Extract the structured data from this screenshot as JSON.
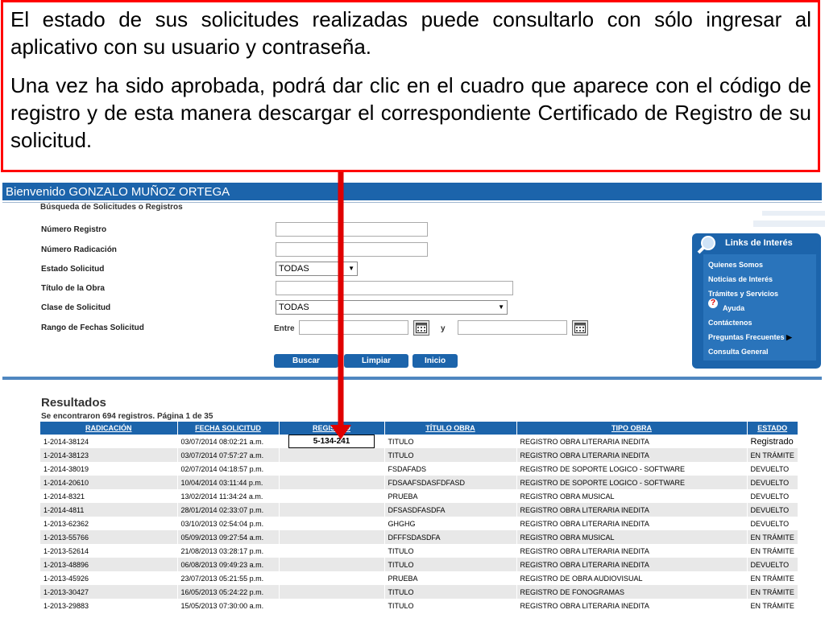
{
  "callout": {
    "paragraph1": "El estado de sus solicitudes realizadas puede consultarlo con sólo ingresar al aplicativo con su usuario y contraseña.",
    "paragraph2": "Una vez ha sido aprobada, podrá dar clic en el cuadro que aparece con el código de registro y de esta manera descargar el correspondiente Certificado de Registro de su solicitud."
  },
  "header": {
    "welcome": "Bienvenido GONZALO MUÑOZ ORTEGA"
  },
  "search": {
    "heading": "Búsqueda de Solicitudes o Registros",
    "labels": {
      "numero_registro": "Número Registro",
      "numero_radicacion": "Número Radicación",
      "estado_solicitud": "Estado Solicitud",
      "titulo_obra": "Título de la Obra",
      "clase_solicitud": "Clase de Solicitud",
      "rango_fechas": "Rango de Fechas Solicitud"
    },
    "estado_value": "TODAS",
    "clase_value": "TODAS",
    "entre_label": "Entre",
    "y_label": "y",
    "buttons": {
      "buscar": "Buscar",
      "limpiar": "Limpiar",
      "inicio": "Inicio"
    }
  },
  "links": {
    "title": "Links de Interés",
    "items": [
      "Quienes Somos",
      "Noticias de Interés",
      "Trámites y Servicios",
      "Ayuda",
      "Contáctenos",
      "Preguntas Frecuentes",
      "Consulta General"
    ]
  },
  "results": {
    "title": "Resultados",
    "count": "Se encontraron 694 registros. Página 1 de 35",
    "headers": [
      "RADICACIÓN",
      "FECHA SOLICITUD",
      "REGISTRO",
      "TÍTULO OBRA",
      "TIPO OBRA",
      "ESTADO"
    ],
    "rows": [
      [
        "1-2014-38124",
        "03/07/2014 08:02:21 a.m.",
        "5-134-241",
        "TITULO",
        "REGISTRO OBRA LITERARIA INEDITA",
        "Registrado"
      ],
      [
        "1-2014-38123",
        "03/07/2014 07:57:27 a.m.",
        "",
        "TITULO",
        "REGISTRO OBRA LITERARIA INEDITA",
        "EN TRÁMITE"
      ],
      [
        "1-2014-38019",
        "02/07/2014 04:18:57 p.m.",
        "",
        "FSDAFADS",
        "REGISTRO DE SOPORTE LOGICO - SOFTWARE",
        "DEVUELTO"
      ],
      [
        "1-2014-20610",
        "10/04/2014 03:11:44 p.m.",
        "",
        "FDSAAFSDASFDFASD",
        "REGISTRO DE SOPORTE LOGICO - SOFTWARE",
        "DEVUELTO"
      ],
      [
        "1-2014-8321",
        "13/02/2014 11:34:24 a.m.",
        "",
        "PRUEBA",
        "REGISTRO OBRA MUSICAL",
        "DEVUELTO"
      ],
      [
        "1-2014-4811",
        "28/01/2014 02:33:07 p.m.",
        "",
        "DFSASDFASDFA",
        "REGISTRO OBRA LITERARIA INEDITA",
        "DEVUELTO"
      ],
      [
        "1-2013-62362",
        "03/10/2013 02:54:04 p.m.",
        "",
        "GHGHG",
        "REGISTRO OBRA LITERARIA INEDITA",
        "DEVUELTO"
      ],
      [
        "1-2013-55766",
        "05/09/2013 09:27:54 a.m.",
        "",
        "DFFFSDASDFA",
        "REGISTRO OBRA MUSICAL",
        "EN TRÁMITE"
      ],
      [
        "1-2013-52614",
        "21/08/2013 03:28:17 p.m.",
        "",
        "TITULO",
        "REGISTRO OBRA LITERARIA INEDITA",
        "EN TRÁMITE"
      ],
      [
        "1-2013-48896",
        "06/08/2013 09:49:23 a.m.",
        "",
        "TITULO",
        "REGISTRO OBRA LITERARIA INEDITA",
        "DEVUELTO"
      ],
      [
        "1-2013-45926",
        "23/07/2013 05:21:55 p.m.",
        "",
        "PRUEBA",
        "REGISTRO DE OBRA AUDIOVISUAL",
        "EN TRÁMITE"
      ],
      [
        "1-2013-30427",
        "16/05/2013 05:24:22 p.m.",
        "",
        "TITULO",
        "REGISTRO DE FONOGRAMAS",
        "EN TRÁMITE"
      ],
      [
        "1-2013-29883",
        "15/05/2013 07:30:00 a.m.",
        "",
        "TITULO",
        "REGISTRO OBRA LITERARIA INEDITA",
        "EN TRÁMITE"
      ]
    ]
  },
  "colors": {
    "callout_border": "#ff0000",
    "primary_blue": "#1c64ab"
  }
}
